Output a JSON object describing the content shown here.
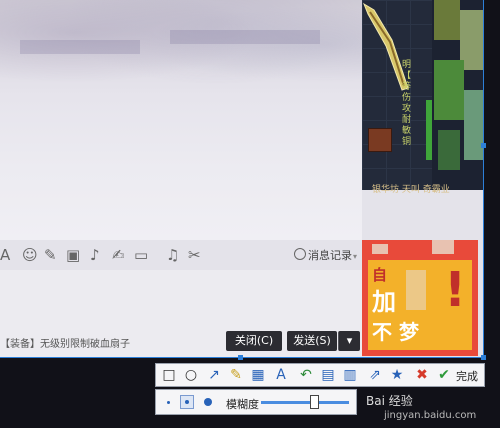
{
  "chat": {
    "history_label": "消息记录",
    "message_text": "【装备】无级别限制破血扇子",
    "close_button": "关闭(C)",
    "send_button": "发送(S)",
    "send_dropdown": "▾"
  },
  "toolbar_icons": [
    {
      "name": "font-icon",
      "glyph": "A"
    },
    {
      "name": "emoji-icon",
      "glyph": "☺"
    },
    {
      "name": "shake-icon",
      "glyph": "✎"
    },
    {
      "name": "video-icon",
      "glyph": "▣"
    },
    {
      "name": "voice-icon",
      "glyph": "♪"
    },
    {
      "name": "edit-icon",
      "glyph": "✍"
    },
    {
      "name": "image-icon",
      "glyph": "▭"
    },
    {
      "name": "music-icon",
      "glyph": "♫"
    },
    {
      "name": "screenshot-icon",
      "glyph": "✂"
    }
  ],
  "ad": {
    "line1": "自",
    "line2": "加",
    "line3": "不",
    "line3b": "梦",
    "bang": "!"
  },
  "game": {
    "text_lines": [
      "明",
      "【",
      "等",
      "伤",
      "攻",
      "耐",
      "敏",
      "铜"
    ],
    "label": "银华坊 天叫 奇霸业"
  },
  "snip_tools": [
    {
      "name": "rectangle-icon",
      "glyph": "□",
      "color": "#333"
    },
    {
      "name": "ellipse-icon",
      "glyph": "○",
      "color": "#333"
    },
    {
      "name": "arrow-icon",
      "glyph": "↗",
      "color": "#2862b8"
    },
    {
      "name": "pen-icon",
      "glyph": "✎",
      "color": "#c8a020"
    },
    {
      "name": "mosaic-icon",
      "glyph": "▦",
      "color": "#2862b8"
    },
    {
      "name": "text-icon",
      "glyph": "A",
      "color": "#2862b8"
    },
    {
      "name": "undo-icon",
      "glyph": "↶",
      "color": "#2e8b3a"
    },
    {
      "name": "save-icon",
      "glyph": "▤",
      "color": "#2862b8"
    },
    {
      "name": "copy-icon",
      "glyph": "▥",
      "color": "#2862b8"
    },
    {
      "name": "share-icon",
      "glyph": "⇗",
      "color": "#2862b8"
    },
    {
      "name": "pin-icon",
      "glyph": "★",
      "color": "#2862b8"
    },
    {
      "name": "cancel-icon",
      "glyph": "✖",
      "color": "#d63a2a"
    },
    {
      "name": "confirm-icon",
      "glyph": "✔",
      "color": "#2e9a3a"
    }
  ],
  "done_label": "完成",
  "blur_label": "模糊度",
  "blur_level": 0.6,
  "watermark": {
    "logo": "Bai 经验",
    "url": "jingyan.baidu.com"
  }
}
